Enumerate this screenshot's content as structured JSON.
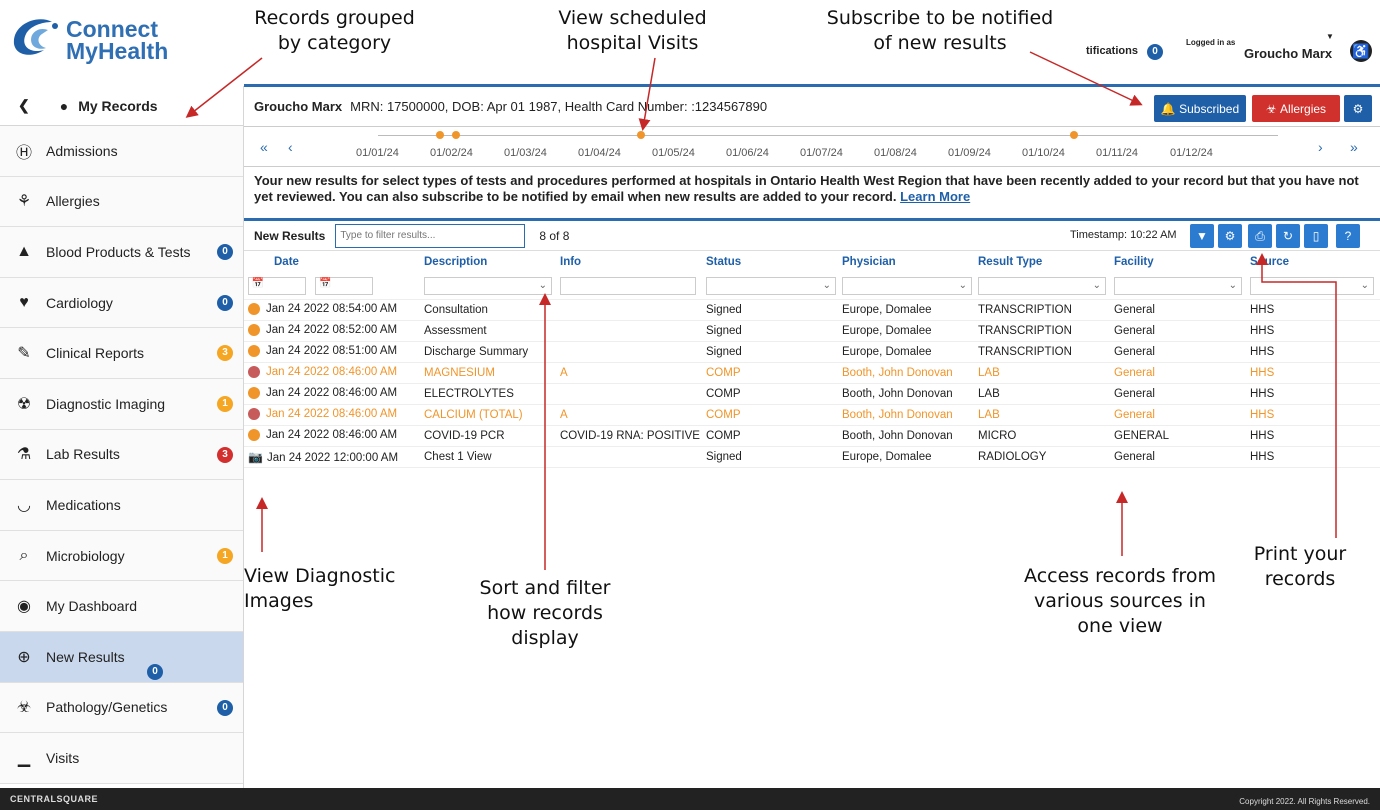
{
  "brand": {
    "line1": "Connect",
    "line2": "MyHealth"
  },
  "callouts": {
    "records": "Records grouped\nby category",
    "visits": "View scheduled\nhospital Visits",
    "subscribe": "Subscribe to be notified\nof new results",
    "images": "View Diagnostic\nImages",
    "sort": "Sort and filter\nhow records\ndisplay",
    "sources": "Access records from\nvarious sources in\none view",
    "print": "Print your\nrecords"
  },
  "header": {
    "notifications_label": "tifications",
    "notifications_count": "0",
    "logged_in_label": "Logged in as",
    "user_name": "Groucho Marx"
  },
  "sidebar": {
    "title": "My Records",
    "items": [
      {
        "label": "Admissions",
        "icon": "hospital-icon",
        "count": "",
        "color": ""
      },
      {
        "label": "Allergies",
        "icon": "allergy-icon",
        "count": "",
        "color": ""
      },
      {
        "label": "Blood Products & Tests",
        "icon": "blood-bag-icon",
        "count": "0",
        "color": "#1e5fa8"
      },
      {
        "label": "Cardiology",
        "icon": "heart-icon",
        "count": "0",
        "color": "#1e5fa8"
      },
      {
        "label": "Clinical Reports",
        "icon": "report-icon",
        "count": "3",
        "color": "#f5a623"
      },
      {
        "label": "Diagnostic Imaging",
        "icon": "radiation-icon",
        "count": "1",
        "color": "#f5a623"
      },
      {
        "label": "Lab Results",
        "icon": "flask-icon",
        "count": "3",
        "color": "#d32f2f"
      },
      {
        "label": "Medications",
        "icon": "medication-icon",
        "count": "",
        "color": ""
      },
      {
        "label": "Microbiology",
        "icon": "microscope-icon",
        "count": "1",
        "color": "#f5a623"
      },
      {
        "label": "My Dashboard",
        "icon": "dashboard-icon",
        "count": "",
        "color": ""
      },
      {
        "label": "New Results",
        "icon": "new-results-icon",
        "count": "0",
        "color": "#1e5fa8"
      },
      {
        "label": "Pathology/Genetics",
        "icon": "biohazard-icon",
        "count": "0",
        "color": "#1e5fa8"
      },
      {
        "label": "Visits",
        "icon": "chart-icon",
        "count": "",
        "color": ""
      }
    ]
  },
  "patient": {
    "name": "Groucho Marx",
    "details": "MRN: 17500000, DOB: Apr 01 1987, Health Card Number: :1234567890",
    "subscribed_label": "Subscribed",
    "allergies_label": "Allergies"
  },
  "timeline": {
    "dates": [
      "01/01/24",
      "01/02/24",
      "01/03/24",
      "01/04/24",
      "01/05/24",
      "01/06/24",
      "01/07/24",
      "01/08/24",
      "01/09/24",
      "01/10/24",
      "01/11/24",
      "01/12/24"
    ]
  },
  "message": {
    "text": "Your new results for select types of tests and procedures performed at hospitals in Ontario Health West Region that have been recently added to your record but that you have not yet reviewed. You can also subscribe to be notified by email when new results are added to your record.",
    "link": "Learn More"
  },
  "results": {
    "title": "New Results",
    "filter_placeholder": "Type to filter results...",
    "count": "8 of 8",
    "timestamp": "Timestamp: 10:22 AM",
    "columns": [
      "Date",
      "Description",
      "Info",
      "Status",
      "Physician",
      "Result Type",
      "Facility",
      "Source"
    ],
    "rows": [
      {
        "date": "Jan 24 2022 08:54:00 AM",
        "desc": "Consultation",
        "info": "",
        "status": "Signed",
        "physician": "Europe, Domalee",
        "type": "TRANSCRIPTION",
        "facility": "General",
        "source": "HHS",
        "flag": "orange",
        "warn": false
      },
      {
        "date": "Jan 24 2022 08:52:00 AM",
        "desc": "Assessment",
        "info": "",
        "status": "Signed",
        "physician": "Europe, Domalee",
        "type": "TRANSCRIPTION",
        "facility": "General",
        "source": "HHS",
        "flag": "orange",
        "warn": false
      },
      {
        "date": "Jan 24 2022 08:51:00 AM",
        "desc": "Discharge Summary",
        "info": "",
        "status": "Signed",
        "physician": "Europe, Domalee",
        "type": "TRANSCRIPTION",
        "facility": "General",
        "source": "HHS",
        "flag": "orange",
        "warn": false
      },
      {
        "date": "Jan 24 2022 08:46:00 AM",
        "desc": "MAGNESIUM",
        "info": "A",
        "status": "COMP",
        "physician": "Booth, John Donovan",
        "type": "LAB",
        "facility": "General",
        "source": "HHS",
        "flag": "red",
        "warn": true
      },
      {
        "date": "Jan 24 2022 08:46:00 AM",
        "desc": "ELECTROLYTES",
        "info": "",
        "status": "COMP",
        "physician": "Booth, John Donovan",
        "type": "LAB",
        "facility": "General",
        "source": "HHS",
        "flag": "orange",
        "warn": false
      },
      {
        "date": "Jan 24 2022 08:46:00 AM",
        "desc": "CALCIUM (TOTAL)",
        "info": "A",
        "status": "COMP",
        "physician": "Booth, John Donovan",
        "type": "LAB",
        "facility": "General",
        "source": "HHS",
        "flag": "red",
        "warn": true
      },
      {
        "date": "Jan 24 2022 08:46:00 AM",
        "desc": "COVID-19 PCR",
        "info": "COVID-19 RNA: POSITIVE",
        "status": "COMP",
        "physician": "Booth, John Donovan",
        "type": "MICRO",
        "facility": "GENERAL",
        "source": "HHS",
        "flag": "orange",
        "warn": false
      },
      {
        "date": "Jan 24 2022 12:00:00 AM",
        "desc": "Chest 1 View",
        "info": "",
        "status": "Signed",
        "physician": "Europe, Domalee",
        "type": "RADIOLOGY",
        "facility": "General",
        "source": "HHS",
        "flag": "camera",
        "warn": false
      }
    ]
  },
  "footer": {
    "brand": "CENTRALSQUARE",
    "copyright": "Copyright 2022. All Rights Reserved."
  }
}
